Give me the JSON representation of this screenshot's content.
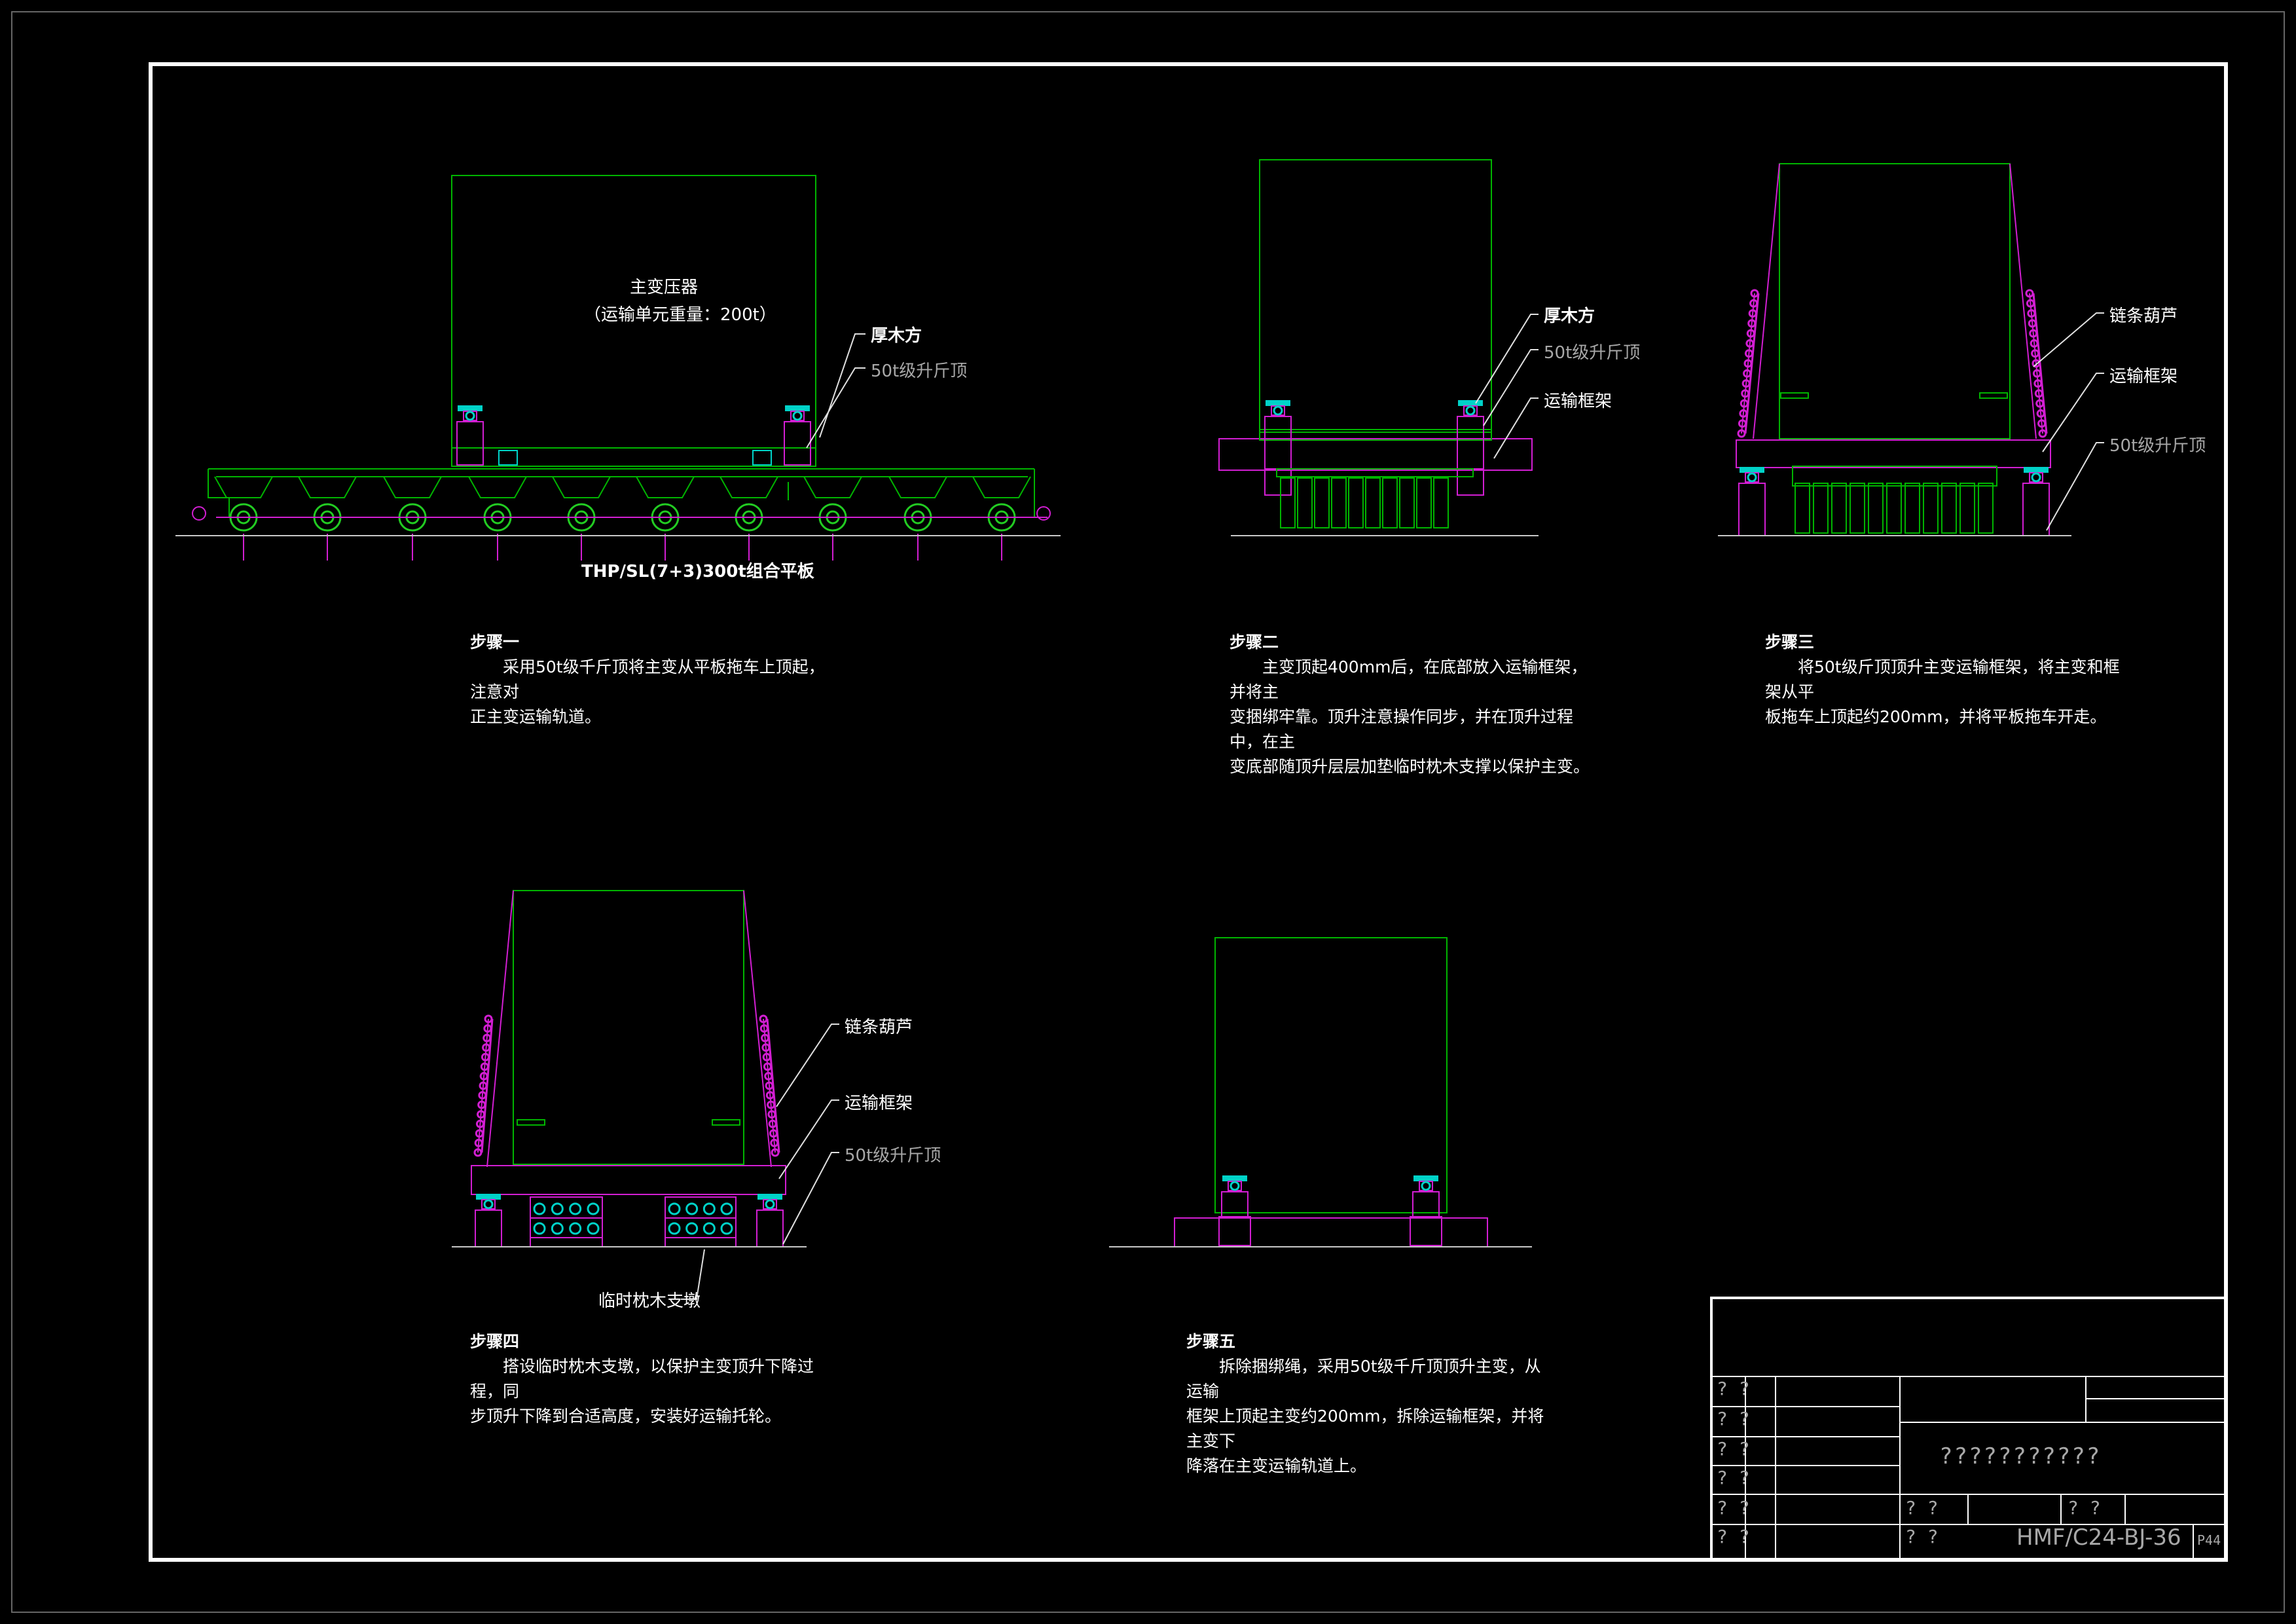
{
  "colors": {
    "background": "#000000",
    "border": "#ffffff",
    "transformer": "#00b400",
    "frame": "#d21ed2",
    "jack": "#00d2c8",
    "wheel": "#22cc22",
    "ground": "#c8c8c8",
    "text": "#ffffff",
    "muted_text": "#a8a8a8"
  },
  "views": {
    "step1": {
      "transformer_name": "主变压器",
      "transformer_weight": "（运输单元重量：200t）",
      "label_timber": "厚木方",
      "label_jack": "50t级升斤顶",
      "trailer_label": "THP/SL(7+3)300t组合平板"
    },
    "step2": {
      "label_timber": "厚木方",
      "label_jack": "50t级升斤顶",
      "label_frame": "运输框架"
    },
    "step3": {
      "label_hoist": "链条葫芦",
      "label_frame": "运输框架",
      "label_jack": "50t级升斤顶"
    },
    "step4": {
      "label_hoist": "链条葫芦",
      "label_frame": "运输框架",
      "label_jack": "50t级升斤顶",
      "label_crib": "临时枕木支墩"
    }
  },
  "steps": [
    {
      "title": "步骤一",
      "text": "　　采用50t级千斤顶将主变从平板拖车上顶起，注意对\n正主变运输轨道。"
    },
    {
      "title": "步骤二",
      "text": "　　主变顶起400mm后，在底部放入运输框架，并将主\n变捆绑牢靠。顶升注意操作同步，并在顶升过程中，在主\n变底部随顶升层层加垫临时枕木支撑以保护主变。"
    },
    {
      "title": "步骤三",
      "text": "　　将50t级斤顶顶升主变运输框架，将主变和框架从平\n板拖车上顶起约200mm，并将平板拖车开走。"
    },
    {
      "title": "步骤四",
      "text": "　　搭设临时枕木支墩，以保护主变顶升下降过程，同\n步顶升下降到合适高度，安装好运输托轮。"
    },
    {
      "title": "步骤五",
      "text": "　　拆除捆绑绳，采用50t级千斤顶顶升主变，从运输\n框架上顶起主变约200mm，拆除运输框架，并将主变下\n降落在主变运输轨道上。"
    }
  ],
  "title_block": {
    "row_marks": [
      "? ?",
      "? ?",
      "? ?",
      "? ?",
      "? ?",
      "? ?"
    ],
    "project_name": "???????????",
    "mark_a": "? ?",
    "mark_b": "? ?",
    "mark_c": "? ?",
    "drawing_no": "HMF/C24-BJ-36",
    "page": "P44"
  }
}
